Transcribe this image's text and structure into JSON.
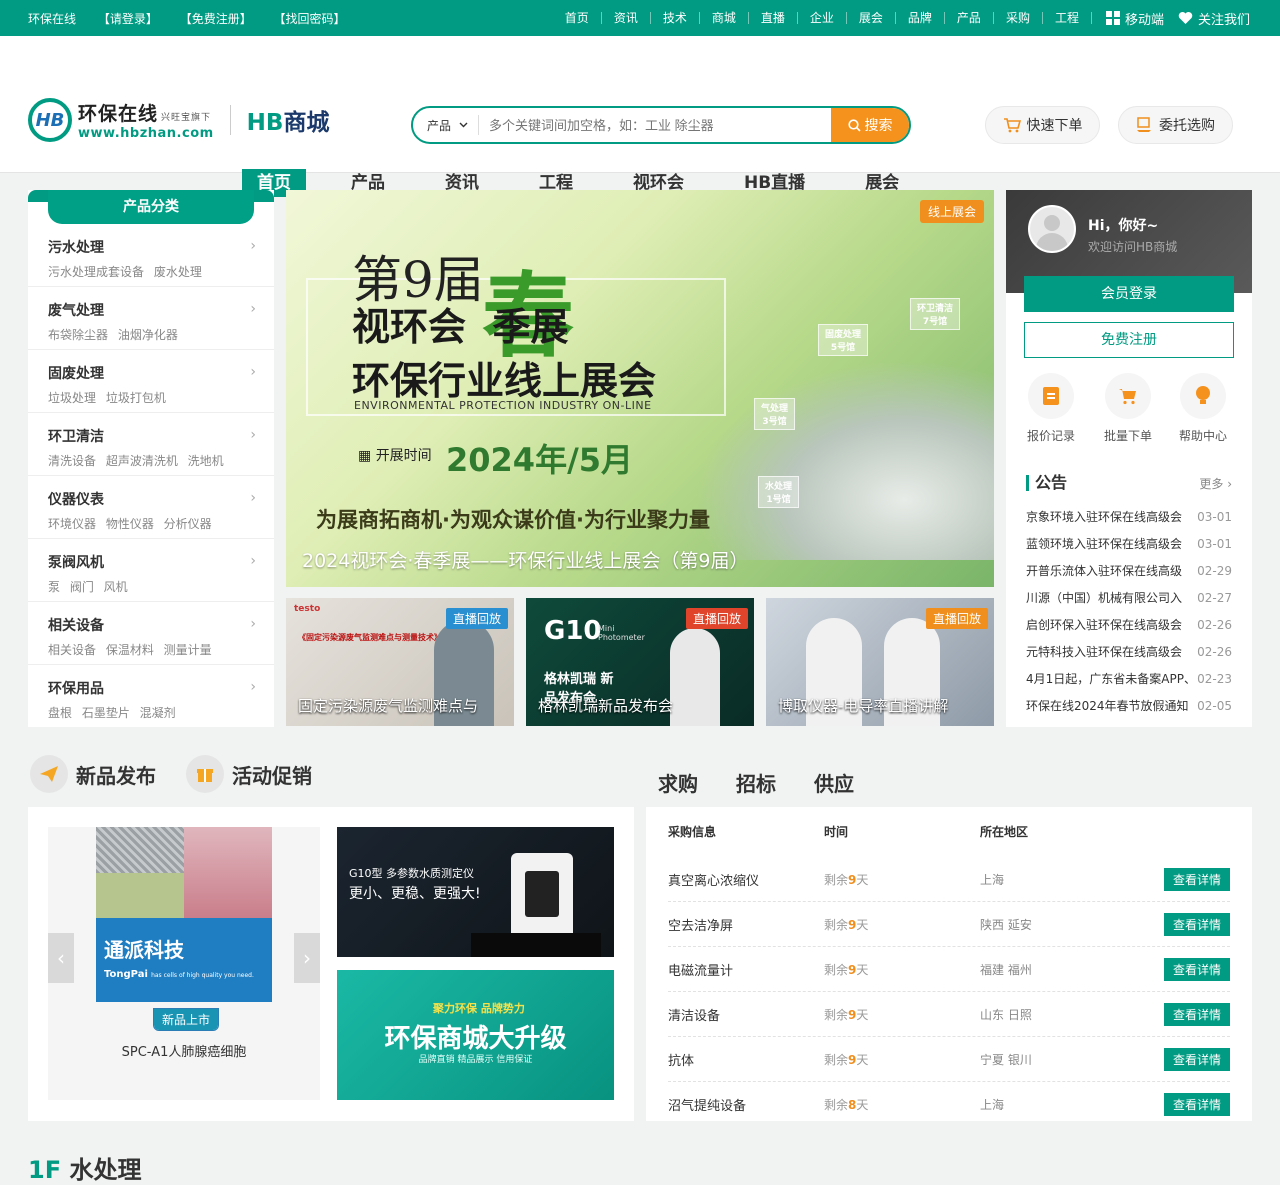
{
  "topbar": {
    "site": "环保在线",
    "login": "【请登录】",
    "register": "【免费注册】",
    "recover": "【找回密码】",
    "links": [
      "首页",
      "资讯",
      "技术",
      "商城",
      "直播",
      "企业",
      "展会",
      "品牌",
      "产品",
      "采购",
      "工程"
    ],
    "mobile": "移动端",
    "follow": "关注我们"
  },
  "logo": {
    "name": "环保在线",
    "sub": "兴旺宝旗下",
    "url": "www.hbzhan.com",
    "mall_a": "HB",
    "mall_b": "商城"
  },
  "search": {
    "category": "产品",
    "placeholder": "多个关键词间加空格，如：工业 除尘器",
    "button": "搜索"
  },
  "actions": {
    "quick_order": "快速下单",
    "entrust": "委托选购"
  },
  "nav": [
    "首页",
    "产品",
    "资讯",
    "工程",
    "视环会",
    "HB直播",
    "展会"
  ],
  "categories_title": "产品分类",
  "categories": [
    {
      "title": "污水处理",
      "subs": "污水处理成套设备 废水处理"
    },
    {
      "title": "废气处理",
      "subs": "布袋除尘器 油烟净化器"
    },
    {
      "title": "固废处理",
      "subs": "垃圾处理 垃圾打包机"
    },
    {
      "title": "环卫清洁",
      "subs": "清洗设备 超声波清洗机 洗地机"
    },
    {
      "title": "仪器仪表",
      "subs": "环境仪器 物性仪器 分析仪器"
    },
    {
      "title": "泵阀风机",
      "subs": "泵 阀门 风机"
    },
    {
      "title": "相关设备",
      "subs": "相关设备 保温材料 测量计量"
    },
    {
      "title": "环保用品",
      "subs": "盘根 石墨垫片 混凝剂"
    }
  ],
  "banner": {
    "tag": "线上展会",
    "line1": "第9届",
    "chun": "春",
    "line2": "视环会  季展",
    "line3": "环保行业线上展会",
    "line4": "ENVIRONMENTAL PROTECTION INDUSTRY ON-LINE",
    "time_label": "开展时间",
    "time": "2024年/5月",
    "slogan": "为展商拓商机·为观众谋价值·为行业聚力量",
    "caption": "2024视环会·春季展——环保行业线上展会（第9届）",
    "halls": [
      {
        "name": "环卫清洁",
        "no": "7号馆"
      },
      {
        "name": "固废处理",
        "no": "5号馆"
      },
      {
        "name": "气处理",
        "no": "3号馆"
      },
      {
        "name": "水处理",
        "no": "1号馆"
      }
    ]
  },
  "videos": [
    {
      "tag": "直播回放",
      "caption": "固定污染源废气监测难点与",
      "brand": "testo",
      "headline": "《固定污染源废气监测难点与测量技术》"
    },
    {
      "tag": "直播回放",
      "caption": "格林凯瑞新品发布会",
      "brand": "G10",
      "sub": "Mini Photometer",
      "headline": "格林凯瑞 新品发布会"
    },
    {
      "tag": "直播回放",
      "caption": "博取仪器-电导率直播讲解"
    }
  ],
  "user": {
    "greeting": "Hi，你好~",
    "welcome": "欢迎访问HB商城",
    "login": "会员登录",
    "register": "免费注册",
    "quick": [
      "报价记录",
      "批量下单",
      "帮助中心"
    ]
  },
  "notice": {
    "title": "公告",
    "more": "更多",
    "items": [
      {
        "text": "京象环境入驻环保在线高级会",
        "date": "03-01"
      },
      {
        "text": "蓝领环境入驻环保在线高级会",
        "date": "03-01"
      },
      {
        "text": "开普乐流体入驻环保在线高级",
        "date": "02-29"
      },
      {
        "text": "川源（中国）机械有限公司入",
        "date": "02-27"
      },
      {
        "text": "启创环保入驻环保在线高级会",
        "date": "02-26"
      },
      {
        "text": "元特科技入驻环保在线高级会",
        "date": "02-26"
      },
      {
        "text": "4月1日起，广东省未备案APP、",
        "date": "02-23"
      },
      {
        "text": "环保在线2024年春节放假通知",
        "date": "02-05"
      }
    ]
  },
  "sections": {
    "new": "新品发布",
    "promo": "活动促销",
    "buy_tabs": [
      "求购",
      "招标",
      "供应"
    ]
  },
  "product": {
    "brand": "通派科技",
    "brand_en": "TongPai",
    "brand_en_sub": "has cells of high quality you need.",
    "tag": "新品上市",
    "name": "SPC-A1人肺腺癌细胞",
    "prev": "‹",
    "next": "›"
  },
  "ad1": {
    "title": "G10型 多参数水质测定仪",
    "slogan": "更小、更稳、更强大!"
  },
  "ad2": {
    "brand": "聚力环保 品牌势力",
    "title": "环保商城大升级",
    "sub": "品牌直销  精品展示  信用保证"
  },
  "buy": {
    "headers": [
      "采购信息",
      "时间",
      "所在地区"
    ],
    "remain_prefix": "剩余",
    "remain_suffix": "天",
    "button": "查看详情",
    "rows": [
      {
        "name": "真空离心浓缩仪",
        "days": "9",
        "area": "上海"
      },
      {
        "name": "空去洁净屏",
        "days": "9",
        "area": "陕西 延安"
      },
      {
        "name": "电磁流量计",
        "days": "9",
        "area": "福建 福州"
      },
      {
        "name": "清洁设备",
        "days": "9",
        "area": "山东 日照"
      },
      {
        "name": "抗体",
        "days": "9",
        "area": "宁夏 银川"
      },
      {
        "name": "沼气提纯设备",
        "days": "8",
        "area": "上海"
      }
    ]
  },
  "next_section": {
    "num": "1F",
    "title": "水处理"
  }
}
